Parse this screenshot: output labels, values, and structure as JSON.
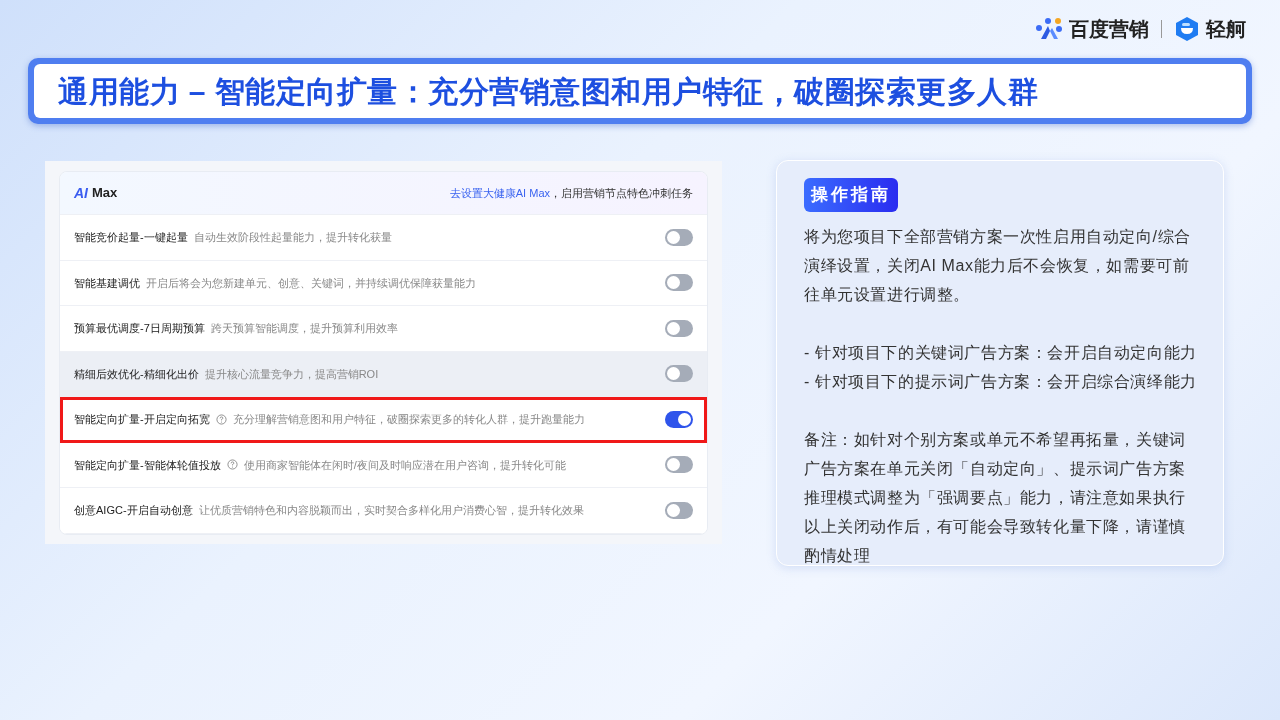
{
  "brand": {
    "name": "百度营销",
    "product": "轻舸"
  },
  "headline": "通用能力 – 智能定向扩量：充分营销意图和用户特征，破圈探索更多人群",
  "screenshot": {
    "logo": "AI",
    "title": "Max",
    "link": "去设置大健康AI Max",
    "link_suffix": "，启用营销节点特色冲刺任务",
    "rows": [
      {
        "title": "智能竞价起量-一键起量",
        "help": false,
        "description": "自动生效阶段性起量能力，提升转化获量",
        "on": false,
        "hovered": false,
        "highlighted": false
      },
      {
        "title": "智能基建调优",
        "help": false,
        "description": "开启后将会为您新建单元、创意、关键词，并持续调优保障获量能力",
        "on": false,
        "hovered": false,
        "highlighted": false
      },
      {
        "title": "预算最优调度-7日周期预算",
        "help": false,
        "description": "跨天预算智能调度，提升预算利用效率",
        "on": false,
        "hovered": false,
        "highlighted": false
      },
      {
        "title": "精细后效优化-精细化出价",
        "help": false,
        "description": "提升核心流量竞争力，提高营销ROI",
        "on": false,
        "hovered": true,
        "highlighted": false
      },
      {
        "title": "智能定向扩量-开启定向拓宽",
        "help": true,
        "description": "充分理解营销意图和用户特征，破圈探索更多的转化人群，提升跑量能力",
        "on": true,
        "hovered": false,
        "highlighted": true
      },
      {
        "title": "智能定向扩量-智能体轮值投放",
        "help": true,
        "description": "使用商家智能体在闲时/夜间及时响应潜在用户咨询，提升转化可能",
        "on": false,
        "hovered": false,
        "highlighted": false
      },
      {
        "title": "创意AIGC-开启自动创意",
        "help": false,
        "description": "让优质营销特色和内容脱颖而出，实时契合多样化用户消费心智，提升转化效果",
        "on": false,
        "hovered": false,
        "highlighted": false
      }
    ]
  },
  "guide": {
    "tag": "操作指南",
    "paragraphs": [
      "将为您项目下全部营销方案一次性启用自动定向/综合演绎设置，关闭AI Max能力后不会恢复，如需要可前往单元设置进行调整。",
      "- 针对项目下的关键词广告方案：会开启自动定向能力\n- 针对项目下的提示词广告方案：会开启综合演绎能力",
      "备注：如针对个别方案或单元不希望再拓量，关键词广告方案在单元关闭「自动定向」、提示词广告方案推理模式调整为「强调要点」能力，请注意如果执行以上关闭动作后，有可能会导致转化量下降，请谨慎酌情处理"
    ]
  }
}
